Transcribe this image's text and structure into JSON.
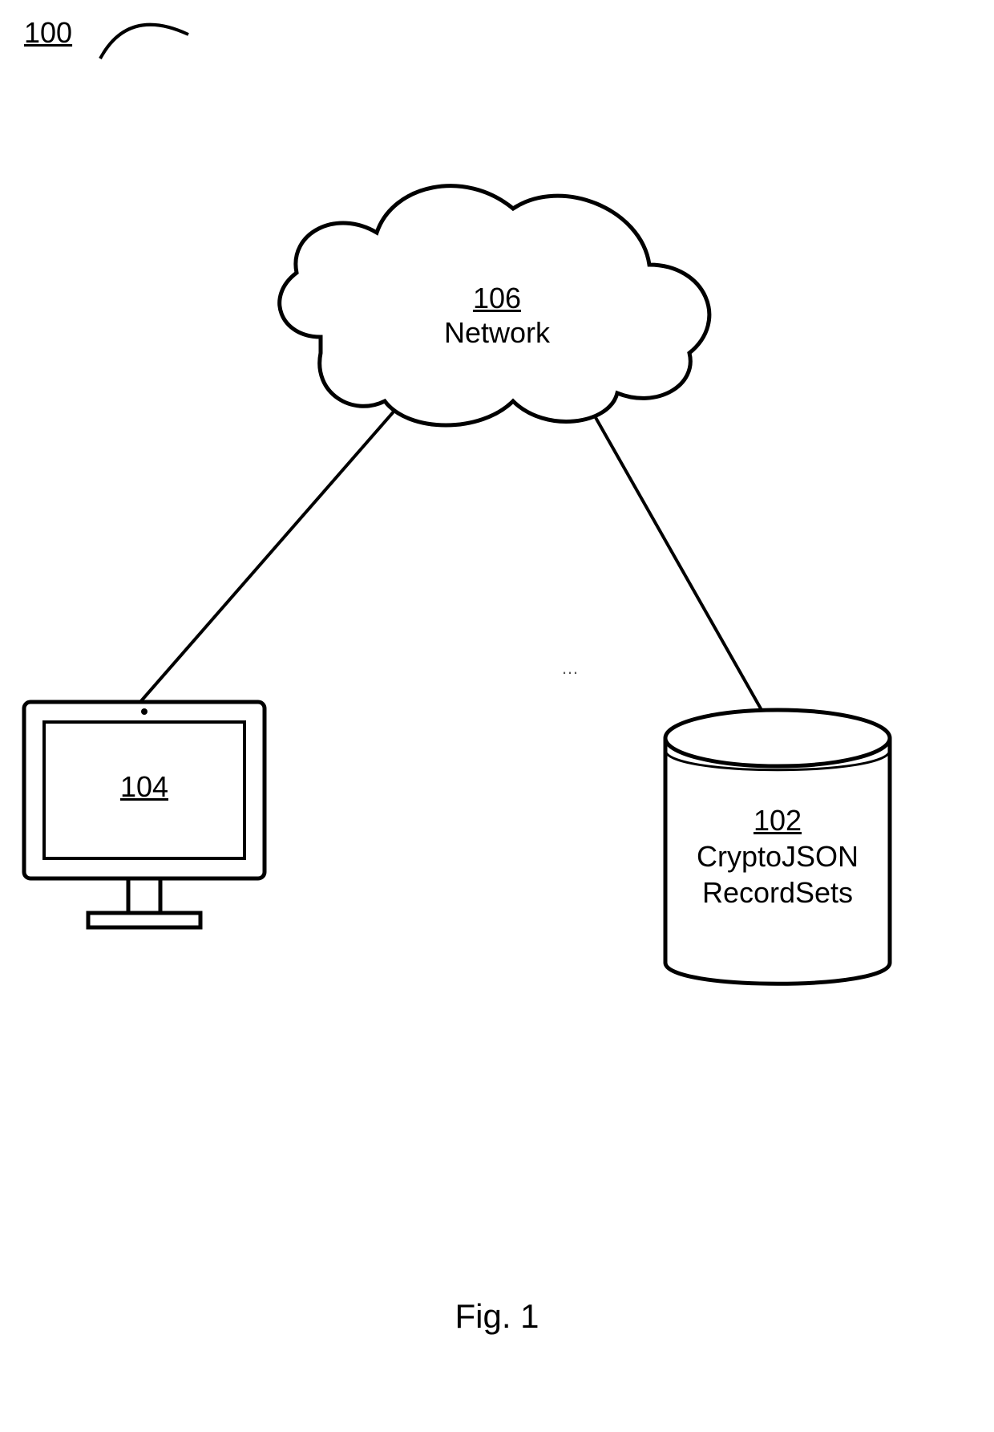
{
  "figure": {
    "overall_ref": "100",
    "caption": "Fig. 1",
    "ellipsis": "…"
  },
  "nodes": {
    "cloud": {
      "ref": "106",
      "label": "Network"
    },
    "client": {
      "ref": "104"
    },
    "database": {
      "ref": "102",
      "label_line1": "CryptoJSON",
      "label_line2": "RecordSets"
    }
  }
}
